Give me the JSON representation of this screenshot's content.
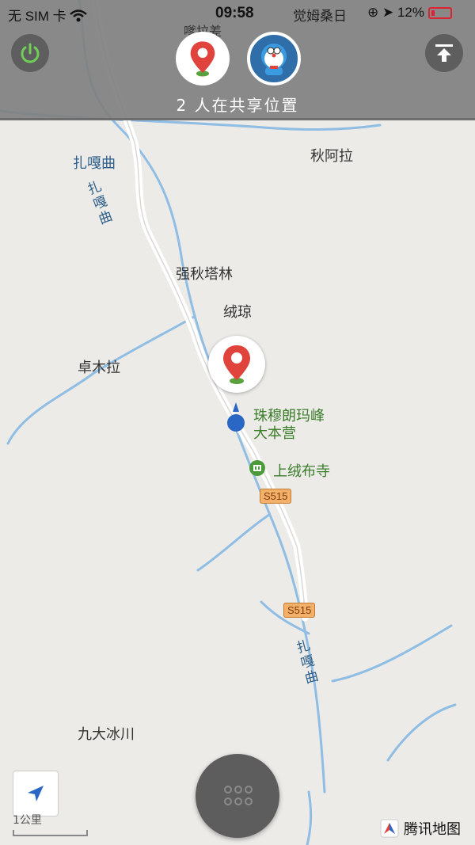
{
  "status_bar": {
    "carrier": "无 SIM 卡",
    "time": "09:58",
    "location_text": "觉姆桑日",
    "battery": "12%",
    "icons": [
      "wifi-icon",
      "rotation-lock-icon",
      "location-arrow-icon",
      "battery-icon"
    ]
  },
  "top_bar": {
    "share_status": "2 人在共享位置",
    "overlapped_label": "嗲拉差",
    "buttons": {
      "power": "power-icon",
      "upload": "upload-icon"
    },
    "avatars": [
      "pin-avatar",
      "doraemon-avatar"
    ]
  },
  "map": {
    "labels": {
      "zhagaqu_top": "扎嘎曲",
      "zhagaqu_river1": "扎嘎曲",
      "qiualala": "秋阿拉",
      "qiangqiu": "强秋塔林",
      "rongqiong": "绒琼",
      "zhuomula": "卓木拉",
      "basecamp": "珠穆朗玛峰\n大本营",
      "temple": "上绒布寺",
      "zhagaqu_river2": "扎嘎曲",
      "jiuda": "九大冰川"
    },
    "road_shields": [
      "S515",
      "S515"
    ],
    "colors": {
      "land": "#ecebe8",
      "road": "#ffffff",
      "river": "#8fbde3",
      "pin": "#e0433c",
      "poi": "#4a9a3a"
    }
  },
  "bottom": {
    "scale": "1公里",
    "brand": "腾讯地图",
    "locate_icon": "navigation-arrow-icon",
    "menu_icon": "grid-dots-icon"
  }
}
